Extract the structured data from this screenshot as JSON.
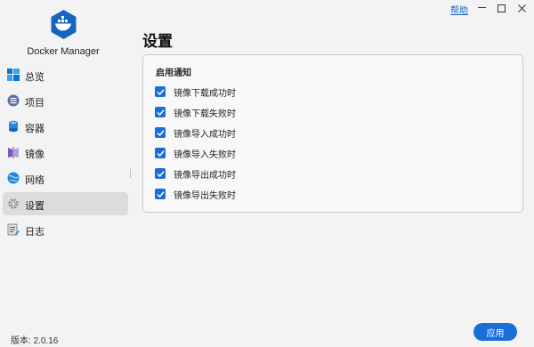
{
  "window": {
    "help_label": "帮助",
    "minimize_glyph": "—",
    "maximize_glyph": "☐",
    "close_glyph": "✕"
  },
  "sidebar": {
    "app_name": "Docker Manager",
    "logo_icon": "docker-whale-icon",
    "items": [
      {
        "label": "总览",
        "icon": "windows-grid-icon",
        "active": false
      },
      {
        "label": "项目",
        "icon": "list-icon",
        "active": false
      },
      {
        "label": "容器",
        "icon": "database-icon",
        "active": false
      },
      {
        "label": "镜像",
        "icon": "mirror-icon",
        "active": false
      },
      {
        "label": "网络",
        "icon": "globe-icon",
        "active": false
      },
      {
        "label": "设置",
        "icon": "gear-icon",
        "active": true
      },
      {
        "label": "日志",
        "icon": "log-icon",
        "active": false
      }
    ],
    "version": "版本: 2.0.16"
  },
  "main": {
    "title": "设置",
    "panel": {
      "header": "启用通知",
      "options": [
        {
          "label": "镜像下载成功时",
          "checked": true
        },
        {
          "label": "镜像下载失败时",
          "checked": true
        },
        {
          "label": "镜像导入成功时",
          "checked": true
        },
        {
          "label": "镜像导入失败时",
          "checked": true
        },
        {
          "label": "镜像导出成功时",
          "checked": true
        },
        {
          "label": "镜像导出失败时",
          "checked": true
        }
      ]
    },
    "apply_label": "应用"
  },
  "colors": {
    "accent": "#1a6ed8",
    "background": "#f3f3f3",
    "active_item": "#dcdcdc"
  }
}
